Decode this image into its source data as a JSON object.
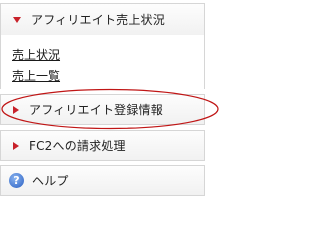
{
  "menu": {
    "affiliate_sales": {
      "label": "アフィリエイト売上状況",
      "icon": "triangle-down-icon",
      "links": [
        {
          "label": "売上状況"
        },
        {
          "label": "売上一覧"
        }
      ]
    },
    "affiliate_registration": {
      "label": "アフィリエイト登録情報",
      "icon": "triangle-right-icon"
    },
    "billing": {
      "label": "FC2への請求処理",
      "icon": "triangle-right-icon"
    },
    "help": {
      "label": "ヘルプ",
      "icon": "help-question-icon",
      "glyph": "?"
    }
  },
  "colors": {
    "accent_red": "#c8212a",
    "highlight_ellipse": "#c01616",
    "border": "#d6d6d6",
    "help_blue": "#2a5fc2"
  }
}
